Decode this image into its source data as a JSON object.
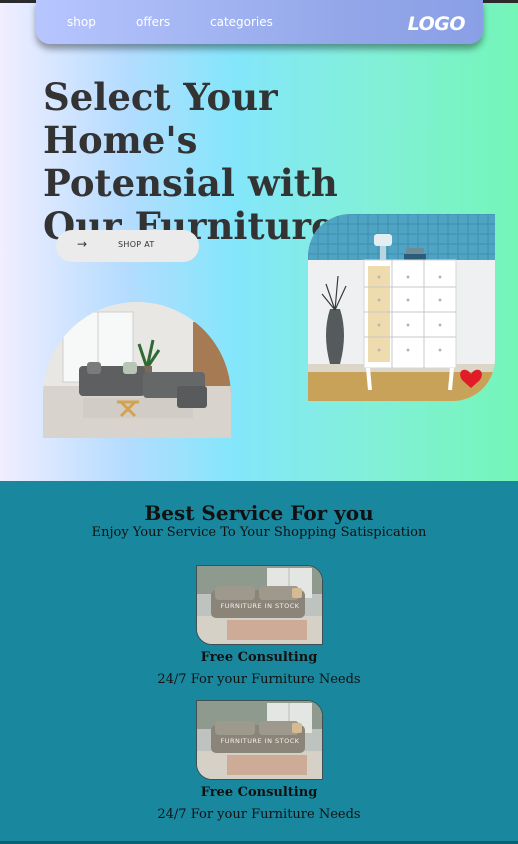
{
  "nav": {
    "links": [
      "shop",
      "offers",
      "categories"
    ],
    "logo": "LOGO"
  },
  "hero": {
    "headline": "Select Your Home's Potensial with Our Furniture",
    "button_label": "SHOP AT"
  },
  "services": {
    "title": "Best Service For you",
    "subtitle": "Enjoy Your Service To Your Shopping Satispication",
    "cards": [
      {
        "title": "Free Consulting",
        "text": "24/7 For your Furniture Needs",
        "image_text": "FURNITURE IN STOCK"
      },
      {
        "title": "Free Consulting",
        "text": "24/7 For your Furniture Needs",
        "image_text": "FURNITURE IN STOCK"
      }
    ]
  },
  "colors": {
    "services_bg": "#19889e",
    "nav_bg": "#a4b6f3",
    "headline": "#333333"
  }
}
